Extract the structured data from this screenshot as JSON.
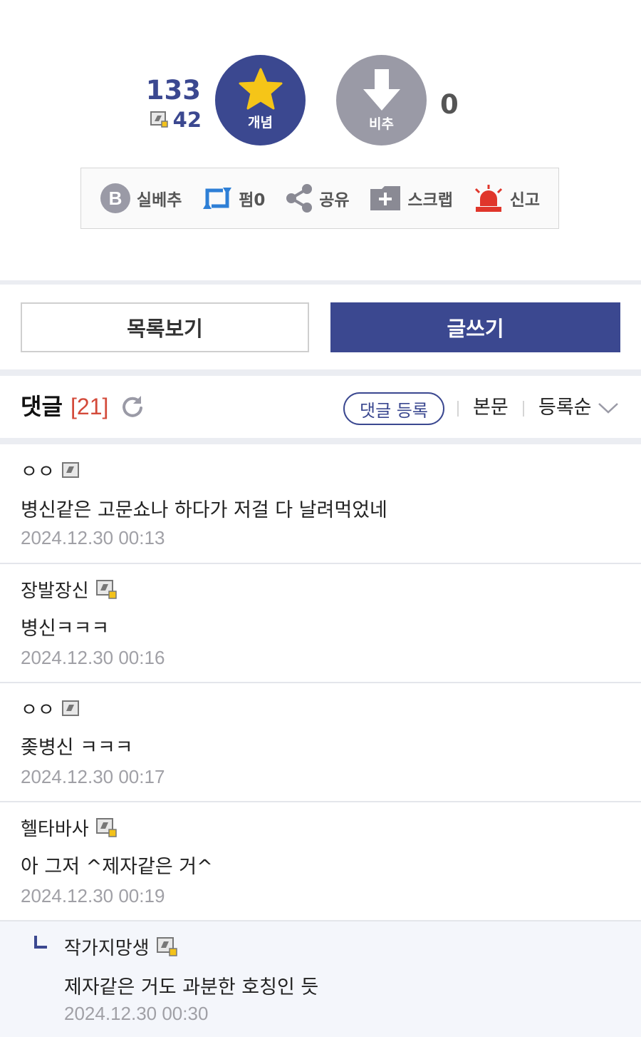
{
  "vote": {
    "up_count": "133",
    "fixed_count": "42",
    "up_label": "개념",
    "down_label": "비추",
    "down_count": "0"
  },
  "actions": [
    {
      "label": "실베추",
      "icon": "b-circle-icon"
    },
    {
      "label": "펌0",
      "icon": "repost-icon"
    },
    {
      "label": "공유",
      "icon": "share-icon"
    },
    {
      "label": "스크랩",
      "icon": "scrap-icon"
    },
    {
      "label": "신고",
      "icon": "siren-icon"
    }
  ],
  "buttons": {
    "list": "목록보기",
    "write": "글쓰기"
  },
  "comments_header": {
    "title": "댓글",
    "count": "[21]",
    "register": "댓글 등록",
    "main_text": "본문",
    "sort": "등록순"
  },
  "comments": [
    {
      "name": "ㅇㅇ",
      "text": "병신같은 고문쇼나 하다가 저걸 다 날려먹었네",
      "date": "2024.12.30 00:13",
      "fixed_nick": false
    },
    {
      "name": "장발장신",
      "text": "병신ㅋㅋㅋ",
      "date": "2024.12.30 00:16",
      "fixed_nick": true
    },
    {
      "name": "ㅇㅇ",
      "text": "좆병신 ㅋㅋㅋ",
      "date": "2024.12.30 00:17",
      "fixed_nick": false
    },
    {
      "name": "헬타바사",
      "text": "아 그저 ^제자같은 거^",
      "date": "2024.12.30 00:19",
      "fixed_nick": true
    },
    {
      "name": "작가지망생",
      "text": "제자같은 거도 과분한 호칭인 듯",
      "date": "2024.12.30 00:30",
      "fixed_nick": true,
      "reply": true
    }
  ],
  "colors": {
    "accent": "#3b4890",
    "down": "#9a9aa6",
    "count_red": "#d34a3a",
    "date_gray": "#a0a0a6"
  }
}
